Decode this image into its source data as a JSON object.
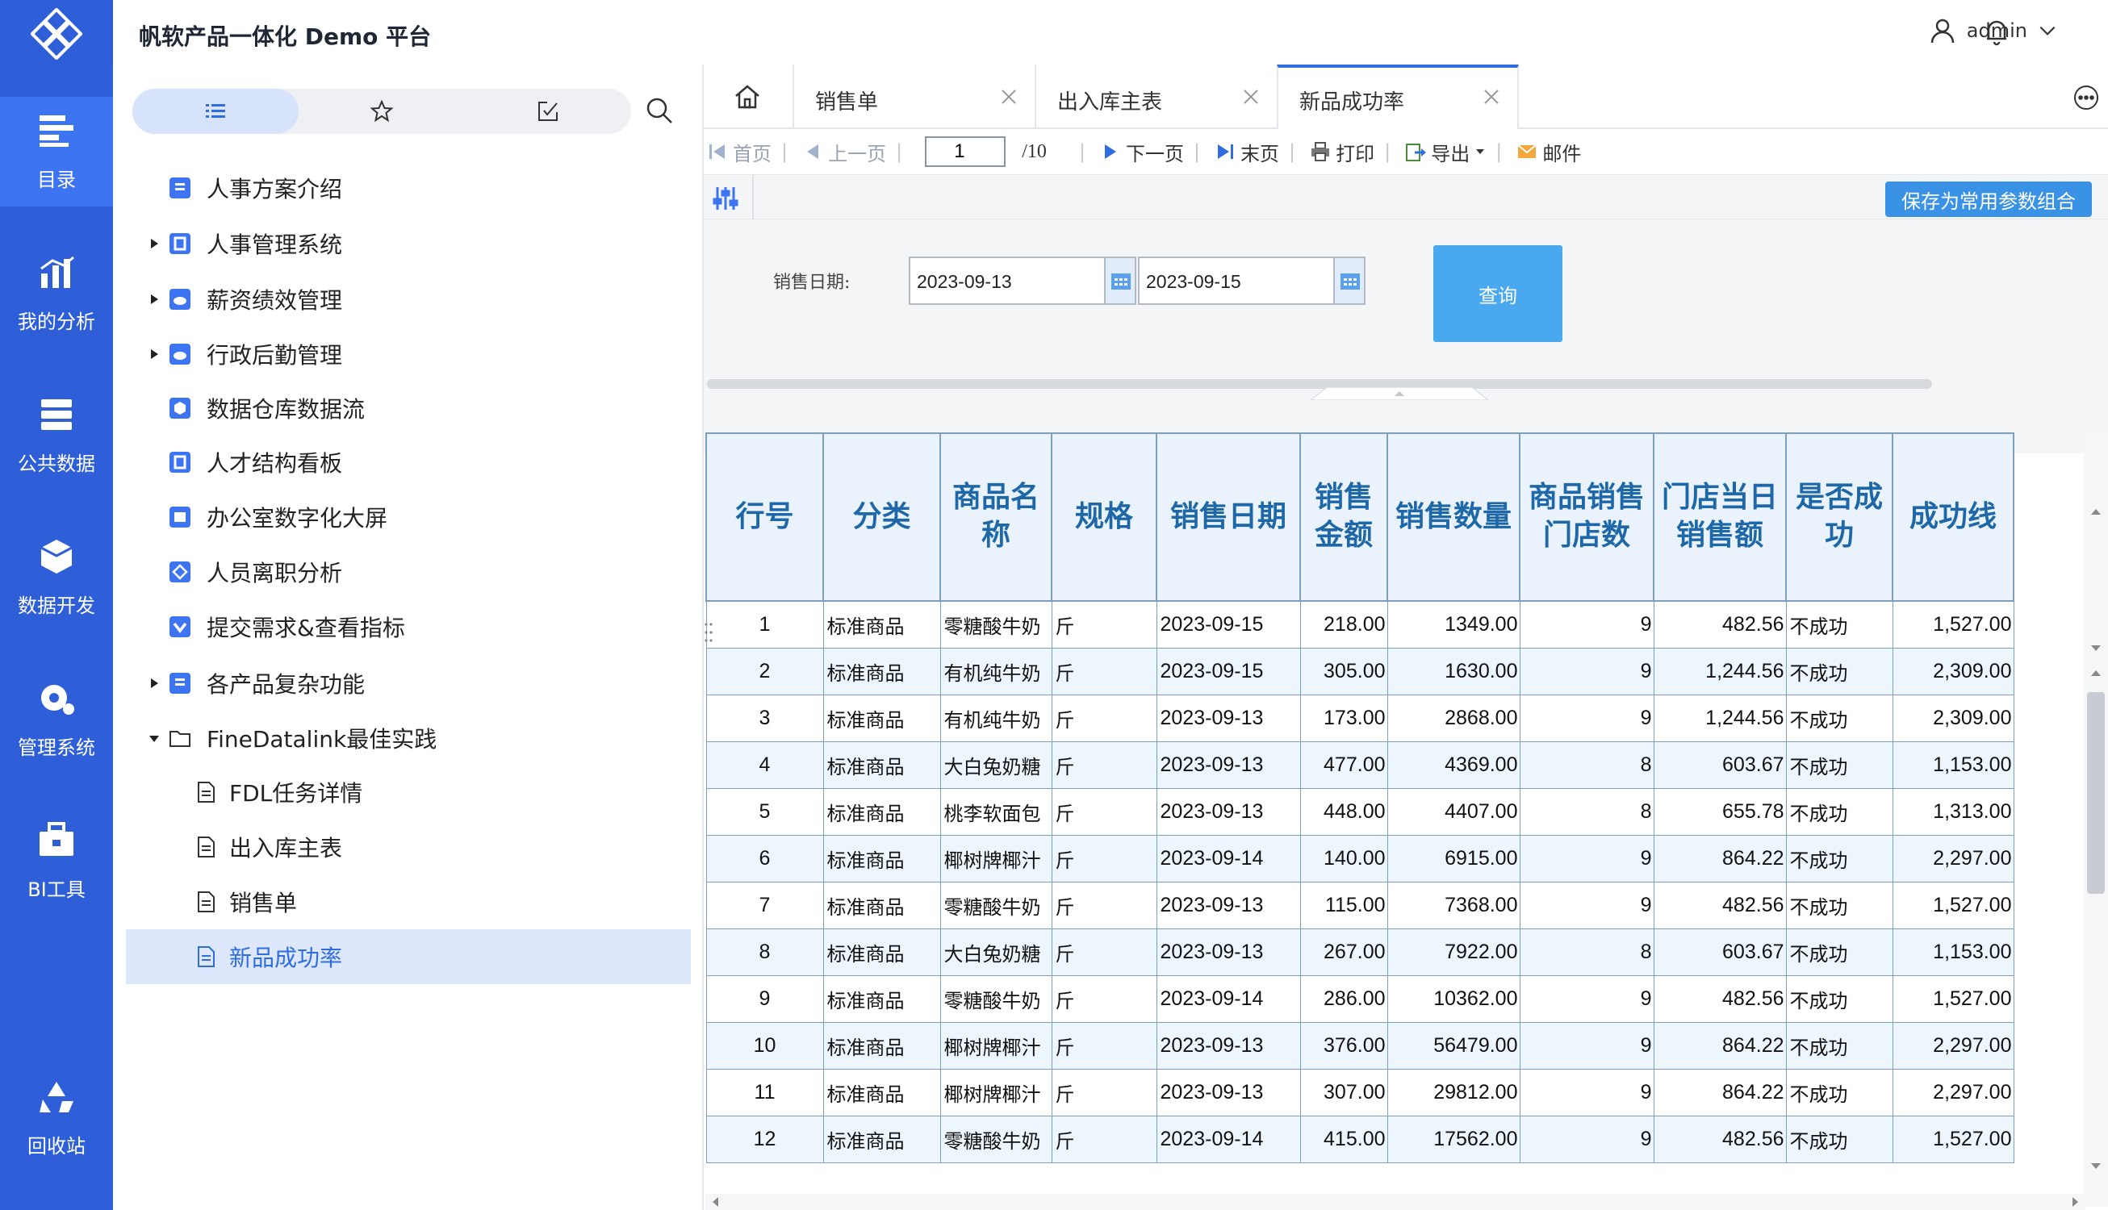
{
  "app": {
    "title": "帆软产品一体化 Demo 平台",
    "user": "admin"
  },
  "rail": [
    {
      "label": "目录",
      "icon": "directory-icon"
    },
    {
      "label": "我的分析",
      "icon": "analysis-icon"
    },
    {
      "label": "公共数据",
      "icon": "database-icon"
    },
    {
      "label": "数据开发",
      "icon": "cube-icon"
    },
    {
      "label": "管理系统",
      "icon": "gear-icon"
    },
    {
      "label": "BI工具",
      "icon": "toolbox-icon"
    },
    {
      "label": "回收站",
      "icon": "recycle-icon"
    }
  ],
  "tree": [
    {
      "label": "人事方案介绍",
      "icon": "report-icon",
      "expandable": false
    },
    {
      "label": "人事管理系统",
      "icon": "app-icon",
      "expandable": true
    },
    {
      "label": "薪资绩效管理",
      "icon": "cloud-icon",
      "expandable": true
    },
    {
      "label": "行政后勤管理",
      "icon": "cloud-icon",
      "expandable": true
    },
    {
      "label": "数据仓库数据流",
      "icon": "cube-icon",
      "expandable": false
    },
    {
      "label": "人才结构看板",
      "icon": "app-icon",
      "expandable": false
    },
    {
      "label": "办公室数字化大屏",
      "icon": "screen-icon",
      "expandable": false
    },
    {
      "label": "人员离职分析",
      "icon": "diamond-icon",
      "expandable": false
    },
    {
      "label": "提交需求&查看指标",
      "icon": "check-icon",
      "expandable": false
    },
    {
      "label": "各产品复杂功能",
      "icon": "report-icon",
      "expandable": true
    },
    {
      "label": "FineDatalink最佳实践",
      "icon": "folder-icon",
      "expanded": true
    },
    {
      "label": "FDL任务详情",
      "icon": "file-icon"
    },
    {
      "label": "出入库主表",
      "icon": "file-icon"
    },
    {
      "label": "销售单",
      "icon": "file-icon"
    },
    {
      "label": "新品成功率",
      "icon": "file-icon",
      "selected": true
    }
  ],
  "tabs": [
    {
      "label": "销售单"
    },
    {
      "label": "出入库主表"
    },
    {
      "label": "新品成功率",
      "active": true
    }
  ],
  "pager": {
    "first": "首页",
    "prev": "上一页",
    "page": "1",
    "total": "/10",
    "next": "下一页",
    "last": "末页",
    "print": "打印",
    "export": "导出",
    "mail": "邮件"
  },
  "params": {
    "save_label": "保存为常用参数组合",
    "date_label": "销售日期:",
    "start_date": "2023-09-13",
    "end_date": "2023-09-15",
    "query_label": "查询"
  },
  "table": {
    "headers": [
      "行号",
      "分类",
      "商品名称",
      "规格",
      "销售日期",
      "销售金额",
      "销售数量",
      "商品销售门店数",
      "门店当日销售额",
      "是否成功",
      "成功线"
    ],
    "rows": [
      [
        "1",
        "标准商品",
        "零糖酸牛奶",
        "斤",
        "2023-09-15",
        "218.00",
        "1349.00",
        "9",
        "482.56",
        "不成功",
        "1,527.00"
      ],
      [
        "2",
        "标准商品",
        "有机纯牛奶",
        "斤",
        "2023-09-15",
        "305.00",
        "1630.00",
        "9",
        "1,244.56",
        "不成功",
        "2,309.00"
      ],
      [
        "3",
        "标准商品",
        "有机纯牛奶",
        "斤",
        "2023-09-13",
        "173.00",
        "2868.00",
        "9",
        "1,244.56",
        "不成功",
        "2,309.00"
      ],
      [
        "4",
        "标准商品",
        "大白兔奶糖",
        "斤",
        "2023-09-13",
        "477.00",
        "4369.00",
        "8",
        "603.67",
        "不成功",
        "1,153.00"
      ],
      [
        "5",
        "标准商品",
        "桃李软面包",
        "斤",
        "2023-09-13",
        "448.00",
        "4407.00",
        "8",
        "655.78",
        "不成功",
        "1,313.00"
      ],
      [
        "6",
        "标准商品",
        "椰树牌椰汁",
        "斤",
        "2023-09-14",
        "140.00",
        "6915.00",
        "9",
        "864.22",
        "不成功",
        "2,297.00"
      ],
      [
        "7",
        "标准商品",
        "零糖酸牛奶",
        "斤",
        "2023-09-13",
        "115.00",
        "7368.00",
        "9",
        "482.56",
        "不成功",
        "1,527.00"
      ],
      [
        "8",
        "标准商品",
        "大白兔奶糖",
        "斤",
        "2023-09-13",
        "267.00",
        "7922.00",
        "8",
        "603.67",
        "不成功",
        "1,153.00"
      ],
      [
        "9",
        "标准商品",
        "零糖酸牛奶",
        "斤",
        "2023-09-14",
        "286.00",
        "10362.00",
        "9",
        "482.56",
        "不成功",
        "1,527.00"
      ],
      [
        "10",
        "标准商品",
        "椰树牌椰汁",
        "斤",
        "2023-09-13",
        "376.00",
        "56479.00",
        "9",
        "864.22",
        "不成功",
        "2,297.00"
      ],
      [
        "11",
        "标准商品",
        "椰树牌椰汁",
        "斤",
        "2023-09-13",
        "307.00",
        "29812.00",
        "9",
        "864.22",
        "不成功",
        "2,297.00"
      ],
      [
        "12",
        "标准商品",
        "零糖酸牛奶",
        "斤",
        "2023-09-14",
        "415.00",
        "17562.00",
        "9",
        "482.56",
        "不成功",
        "1,527.00"
      ]
    ]
  },
  "colors": {
    "rail": "#2f5fd8",
    "rail_active": "#3d74f1",
    "accent": "#2f6ce0",
    "header_text": "#1f68a8",
    "query_button": "#4aa8ee"
  }
}
